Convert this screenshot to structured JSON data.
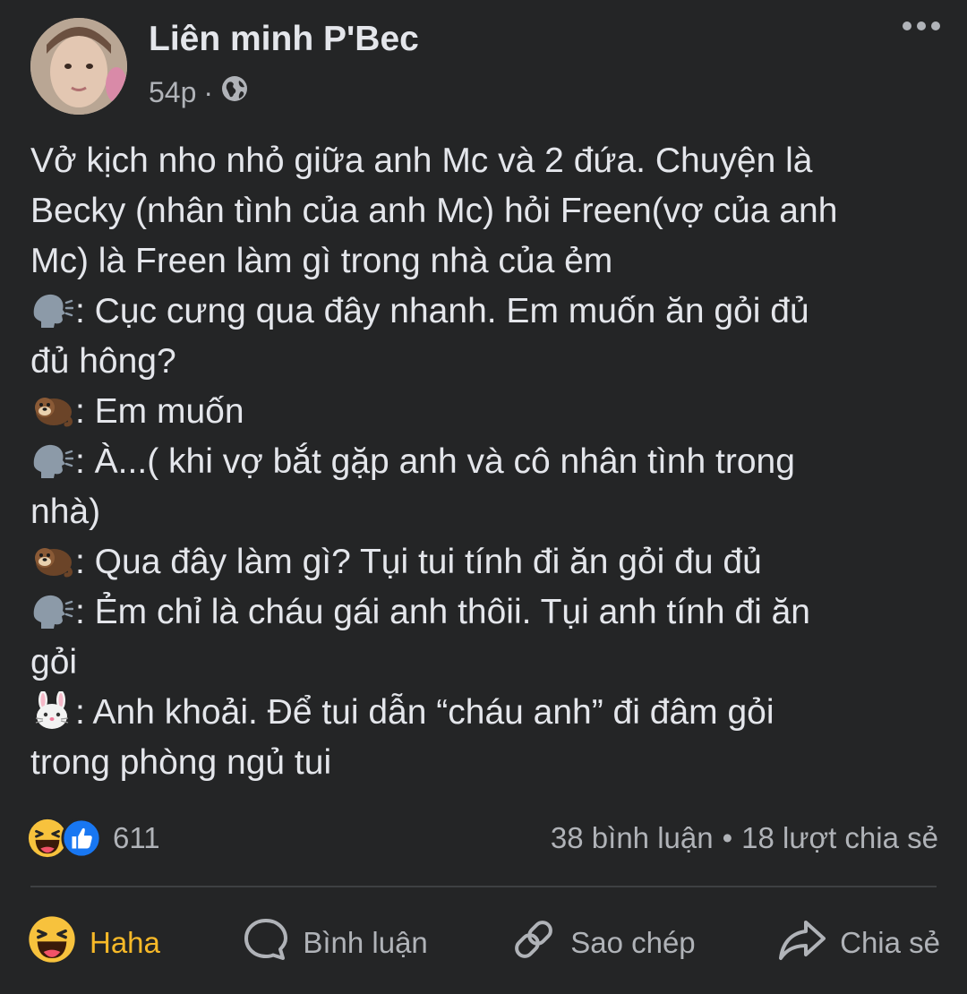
{
  "post": {
    "author": "Liên minh P'Bec",
    "time": "54p",
    "separator": "·",
    "privacy_icon": "globe-icon",
    "more_icon": "more-options-icon",
    "lines": [
      {
        "emoji": "",
        "text": "Vở kịch nho nhỏ giữa anh Mc và 2 đứa. Chuyện là"
      },
      {
        "emoji": "",
        "text": "Becky (nhân tình của anh Mc) hỏi Freen(vợ của anh"
      },
      {
        "emoji": "",
        "text": "Mc) là Freen làm gì trong nhà của ẻm"
      },
      {
        "emoji": "speaking-head",
        "text": ": Cục cưng qua đây nhanh. Em muốn ăn gỏi đủ"
      },
      {
        "emoji": "",
        "text": "đủ hông?"
      },
      {
        "emoji": "otter",
        "text": ": Em muốn"
      },
      {
        "emoji": "speaking-head",
        "text": ": À...( khi vợ bắt gặp anh và cô nhân tình trong"
      },
      {
        "emoji": "",
        "text": "nhà)"
      },
      {
        "emoji": "otter",
        "text": ": Qua đây làm gì? Tụi tui tính đi ăn gỏi đu đủ"
      },
      {
        "emoji": "speaking-head",
        "text": ": Ẻm chỉ là cháu gái anh thôii. Tụi anh tính đi ăn"
      },
      {
        "emoji": "",
        "text": "gỏi"
      },
      {
        "emoji": "rabbit-face",
        "text": ": Anh khoải. Để tui dẫn “cháu anh” đi đâm gỏi"
      },
      {
        "emoji": "",
        "text": "trong phòng ngủ tui"
      }
    ]
  },
  "stats": {
    "reaction_icons": [
      "haha-reaction-icon",
      "like-reaction-icon"
    ],
    "reaction_count": "611",
    "comments": "38 bình luận",
    "bullet": "•",
    "shares": "18 lượt chia sẻ"
  },
  "actions": {
    "haha_label": "Haha",
    "comment_label": "Bình luận",
    "copy_label": "Sao chép",
    "share_label": "Chia sẻ"
  },
  "colors": {
    "background": "#242526",
    "text": "#e4e6eb",
    "secondary": "#b0b3b8",
    "haha": "#f7b928",
    "like": "#1877f2",
    "divider": "#3e4042"
  }
}
